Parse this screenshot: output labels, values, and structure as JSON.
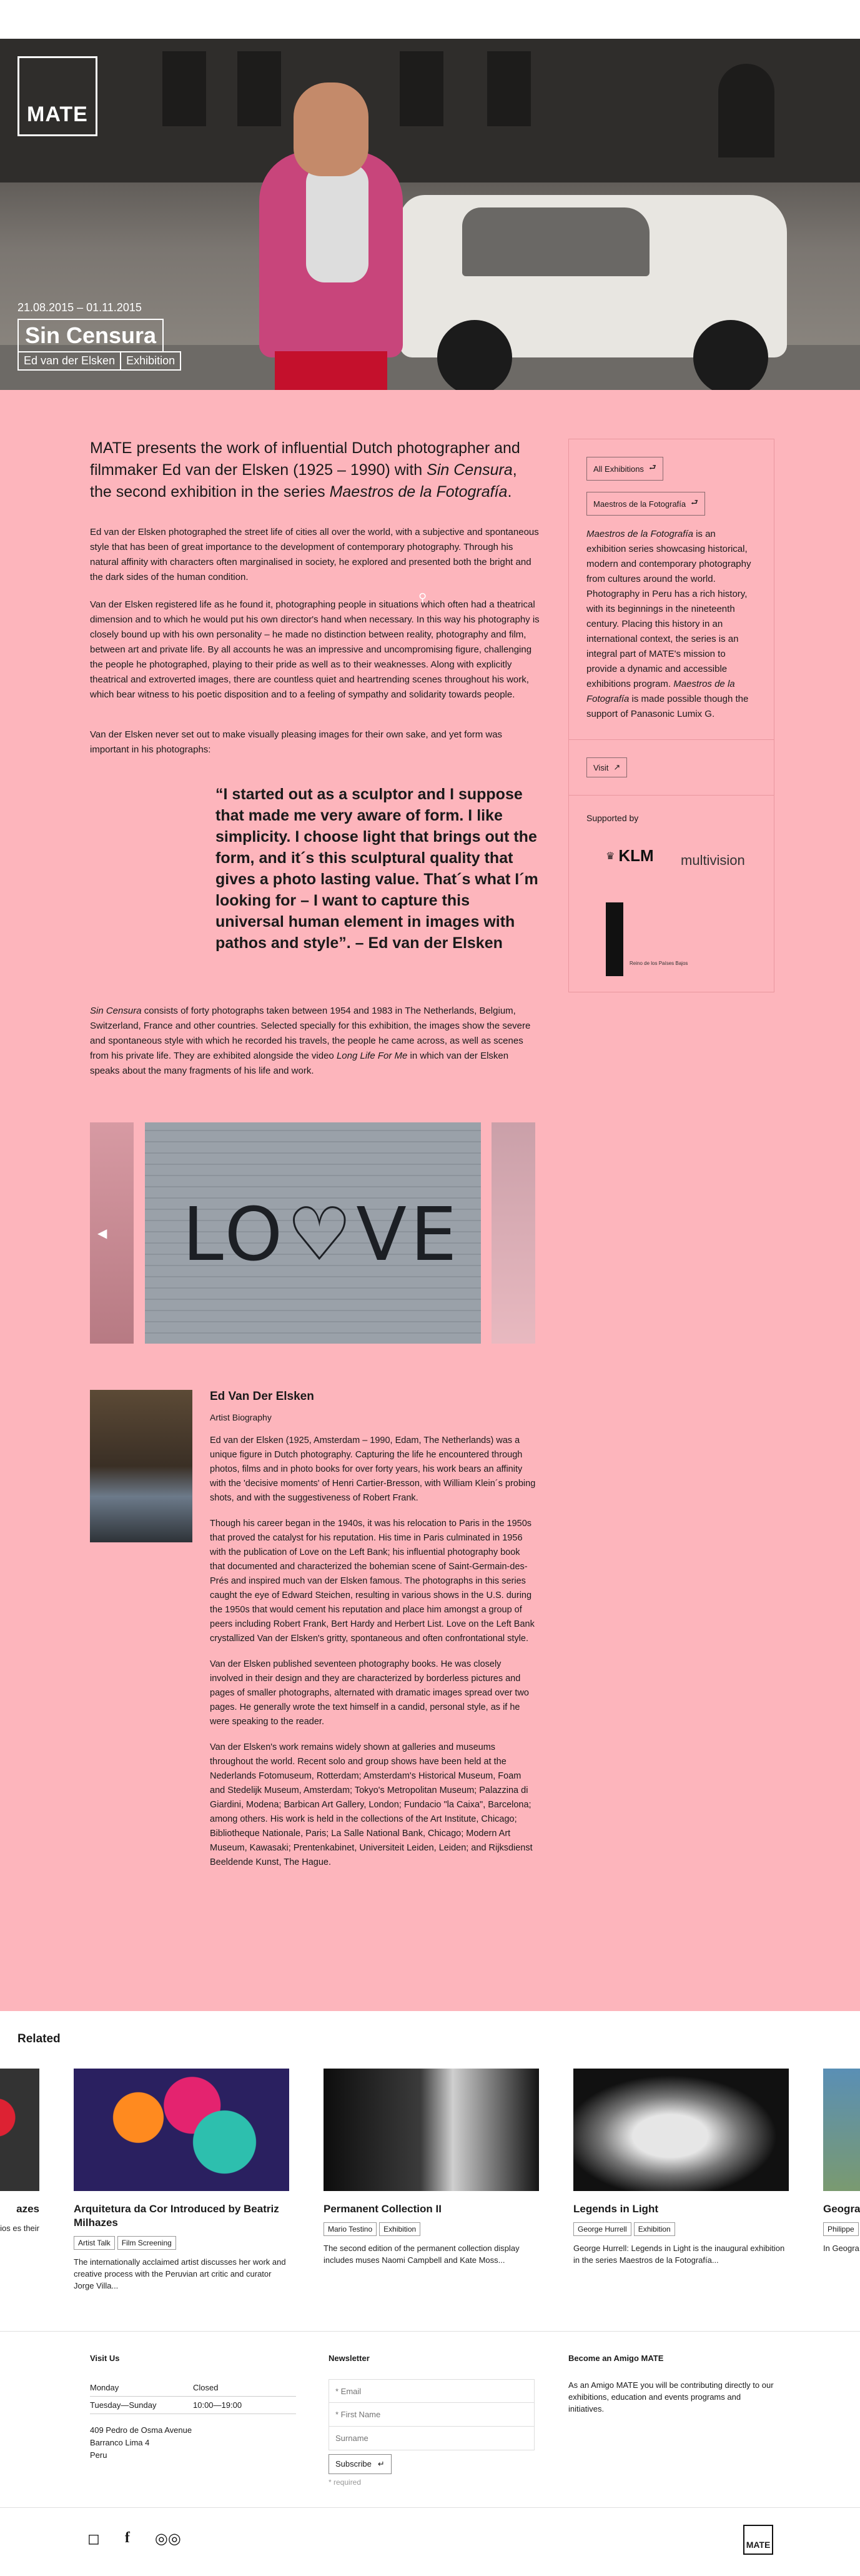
{
  "hero": {
    "logo": "MATE",
    "dates": "21.08.2015 – 01.11.2015",
    "title": "Sin Censura",
    "tags": [
      "Ed van der Elsken",
      "Exhibition"
    ]
  },
  "lead": {
    "p1": "MATE presents the work of influential Dutch photographer and filmmaker Ed van der Elsken (1925 – 1990) with ",
    "title_em": "Sin Censura",
    "p2": ", the second exhibition in the series ",
    "series_em": "Maestros de la Fotografía",
    "p3": "."
  },
  "body": {
    "p1": "Ed van der Elsken photographed the street life of cities all over the world, with a subjective and spontaneous style that has been of great importance to the development of contemporary photography. Through his natural affinity with characters often marginalised in society, he explored and presented both the bright and the dark sides of the human condition.",
    "p2": "Van der Elsken registered life as he found it, photographing people in situations which often had a theatrical dimension and to which he would put his own director's hand when necessary. In this way his photography is closely bound up with his own personality – he made no distinction between reality, photography and film, between art and private life. By all accounts he was an impressive and uncompromising figure, challenging the people he photographed, playing to their pride as well as to their weaknesses. Along with explicitly theatrical and extroverted images, there are countless quiet and heartrending scenes throughout his work, which bear witness to his poetic disposition and to a feeling of sympathy and solidarity towards people.",
    "p3": "Van der Elsken never set out to make visually pleasing images for their own sake, and yet form was important in his photographs:",
    "quote": "“I started out as a sculptor and I suppose that made me very aware of form. I like simplicity. I choose light that brings out the form, and it´s this sculptural quality that gives a photo lasting value. That´s what I´m looking for – I want to capture this universal human element in images with pathos and style”. – Ed van der Elsken",
    "p4_em": "Sin Censura",
    "p4": " consists of forty photographs taken between 1954 and 1983 in The Netherlands, Belgium, Switzerland, France and other countries. Selected specially for this exhibition, the images show the severe and spontaneous style with which he recorded his travels, the people he came across, as well as scenes from his private life. They are exhibited alongside the video ",
    "p4_em2": "Long Life For Me",
    "p4b": " in which van der Elsken speaks about the many fragments of his life and work."
  },
  "aside": {
    "btn_all": "All Exhibitions",
    "btn_maestros": "Maestros de la Fotografía",
    "desc_em": "Maestros de la Fotografía",
    "desc": " is an exhibition series showcasing historical, modern and contemporary photography from cultures around the world. Photography in Peru has a rich history, with its beginnings in the nineteenth century. Placing this history in an international context, the series is an integral part of MATE's mission to provide a dynamic and accessible exhibitions program. ",
    "desc_em2": "Maestros de la Fotografía",
    "desc2": " is made possible though the support of Panasonic Lumix G.",
    "btn_visit": "Visit",
    "supported": "Supported by",
    "sponsor1": "KLM",
    "sponsor2": "multivision",
    "sponsor3": "Reino de los Países Bajos"
  },
  "gallery": {
    "graffiti": "LO♡VE"
  },
  "artist": {
    "name": "Ed Van Der Elsken",
    "sub": "Artist Biography",
    "p1": "Ed van der Elsken (1925, Amsterdam – 1990, Edam, The Netherlands) was a unique figure in Dutch photography. Capturing the life he encountered through photos, films and in photo books for over forty years, his work bears an affinity with the 'decisive moments' of Henri Cartier-Bresson, with William Klein´s probing shots, and with the suggestiveness of Robert Frank.",
    "p2": "Though his career began in the 1940s, it was his relocation to Paris in the 1950s that proved the catalyst for his reputation. His time in Paris culminated in 1956 with the publication of Love on the Left Bank; his influential photography book that documented and characterized the bohemian scene of Saint-Germain-des-Prés and inspired much van der Elsken famous. The photographs in this series caught the eye of Edward Steichen, resulting in various shows in the U.S. during the 1950s that would cement his reputation and place him amongst a group of peers including Robert Frank, Bert Hardy and Herbert List. Love on the Left Bank crystallized Van der Elsken's gritty, spontaneous and often confrontational style.",
    "p3": "Van der Elsken published seventeen photography books. He was closely involved in their design and they are characterized by borderless pictures and pages of smaller photographs, alternated with dramatic images spread over two pages. He generally wrote the text himself in a candid, personal style, as if he were speaking to the reader.",
    "p4": "Van der Elsken's work remains widely shown at galleries and museums throughout the world. Recent solo and group shows have been held at the Nederlands Fotomuseum, Rotterdam; Amsterdam's Historical Museum, Foam and Stedelijk Museum, Amsterdam; Tokyo's Metropolitan Museum; Palazzina di Giardini, Modena; Barbican Art Gallery, London; Fundacio \"la Caixa\", Barcelona; among others. His work is held in the collections of the Art Institute, Chicago; Bibliotheque Nationale, Paris; La Salle National Bank, Chicago; Modern Art Museum, Kawasaki; Prentenkabinet, Universiteit Leiden, Leiden; and Rijksdienst Beeldende Kunst, The Hague."
  },
  "related": {
    "title": "Related",
    "cards": [
      {
        "title": "azes",
        "tags": [],
        "desc": "ortfolios es their"
      },
      {
        "title": "Arquitetura da Cor Introduced by Beatriz Milhazes",
        "tags": [
          "Artist Talk",
          "Film Screening"
        ],
        "desc": "The internationally acclaimed artist discusses her work and creative process with the Peruvian art critic and curator Jorge Villa..."
      },
      {
        "title": "Permanent Collection II",
        "tags": [
          "Mario Testino",
          "Exhibition"
        ],
        "desc": "The second edition of the permanent collection display includes muses Naomi Campbell and Kate Moss..."
      },
      {
        "title": "Legends in Light",
        "tags": [
          "George Hurrell",
          "Exhibition"
        ],
        "desc": "George Hurrell: Legends in Light is the inaugural exhibition in the series Maestros de la Fotografía..."
      },
      {
        "title": "Geogra",
        "tags": [
          "Philippe"
        ],
        "desc": "In Geogra highlight the conte"
      }
    ]
  },
  "footer": {
    "visit_title": "Visit Us",
    "hours": [
      {
        "day": "Monday",
        "time": "Closed"
      },
      {
        "day": "Tuesday—Sunday",
        "time": "10:00—19:00"
      }
    ],
    "address": [
      "409 Pedro de Osma Avenue",
      "Barranco Lima 4",
      "Peru"
    ],
    "newsletter_title": "Newsletter",
    "email_ph": "* Email",
    "first_ph": "* First Name",
    "surname_ph": "Surname",
    "subscribe": "Subscribe",
    "required": "* required",
    "amigo_title": "Become an Amigo MATE",
    "amigo_desc": "As an Amigo MATE you will be contributing directly to our exhibitions, education and events programs and initiatives.",
    "logo": "MATE"
  }
}
